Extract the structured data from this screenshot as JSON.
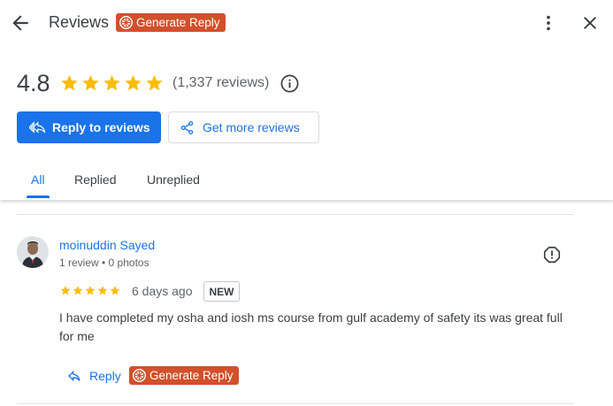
{
  "header": {
    "title": "Reviews",
    "generate_reply_label": "Generate Reply"
  },
  "summary": {
    "rating": "4.8",
    "stars": 5,
    "review_count": "(1,337 reviews)"
  },
  "actions": {
    "reply_to_reviews": "Reply to reviews",
    "get_more_reviews": "Get more reviews"
  },
  "tabs": [
    {
      "label": "All",
      "active": true
    },
    {
      "label": "Replied",
      "active": false
    },
    {
      "label": "Unreplied",
      "active": false
    }
  ],
  "review": {
    "name": "moinuddin Sayed",
    "meta": "1 review • 0 photos",
    "stars": 5,
    "date": "6 days ago",
    "badge": "NEW",
    "text": "I have completed my osha and iosh ms course from gulf academy of safety its was great full for me",
    "reply_label": "Reply",
    "generate_reply_label": "Generate Reply"
  },
  "colors": {
    "accent": "#1a73e8",
    "star": "#fbbc04",
    "generate_badge": "#d2502b"
  }
}
